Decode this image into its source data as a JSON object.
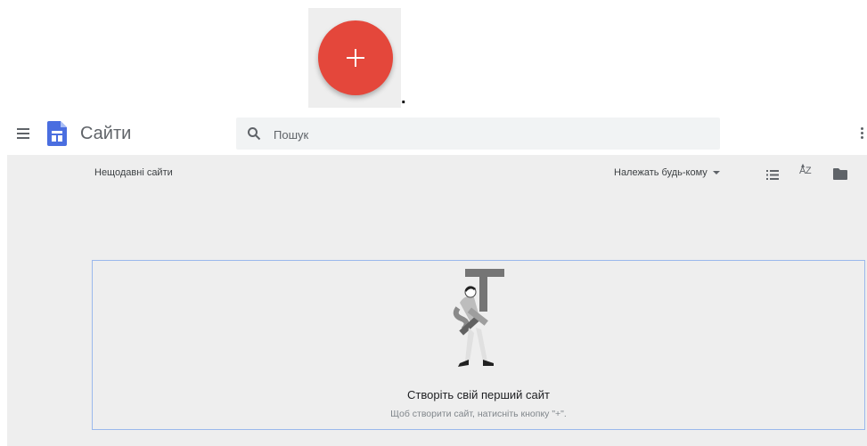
{
  "fab": {
    "icon": "plus-icon",
    "color": "#e4473b"
  },
  "period": ".",
  "header": {
    "menu_icon": "hamburger-menu-icon",
    "logo_icon": "google-sites-logo-icon",
    "logo_color": "#4a6ee0",
    "title": "Сайти",
    "search": {
      "placeholder": "Пошук",
      "value": ""
    },
    "more_icon": "more-vert-icon"
  },
  "toolbar": {
    "recent_label": "Нещодавні сайти",
    "owner_filter": "Належать будь-кому",
    "list_icon": "list-view-icon",
    "sort_icon": "sort-az-icon",
    "sort_label": "AZ",
    "folder_icon": "folder-icon"
  },
  "empty_state": {
    "illustration": "person-carrying-letter-t-illustration",
    "title": "Створіть свій перший сайт",
    "subtitle": "Щоб створити сайт, натисніть кнопку \"+\"."
  }
}
